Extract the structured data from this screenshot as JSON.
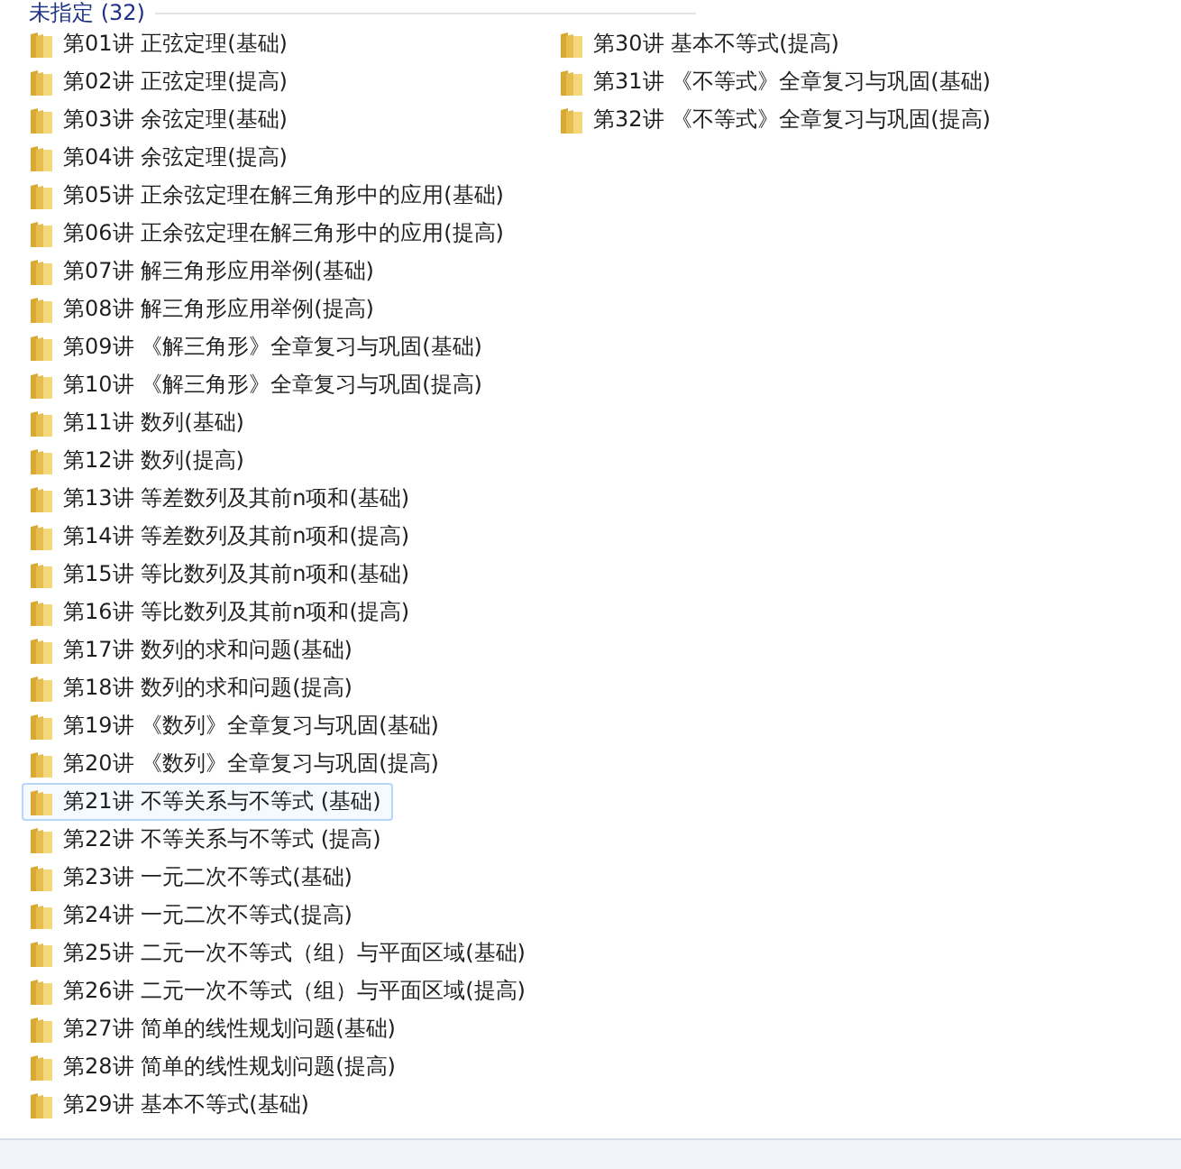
{
  "group": {
    "title": "未指定 (32)"
  },
  "items": [
    {
      "name": "第01讲 正弦定理(基础)",
      "selected": false
    },
    {
      "name": "第02讲 正弦定理(提高)",
      "selected": false
    },
    {
      "name": "第03讲 余弦定理(基础)",
      "selected": false
    },
    {
      "name": "第04讲 余弦定理(提高)",
      "selected": false
    },
    {
      "name": "第05讲 正余弦定理在解三角形中的应用(基础)",
      "selected": false
    },
    {
      "name": "第06讲 正余弦定理在解三角形中的应用(提高)",
      "selected": false
    },
    {
      "name": "第07讲 解三角形应用举例(基础)",
      "selected": false
    },
    {
      "name": "第08讲 解三角形应用举例(提高)",
      "selected": false
    },
    {
      "name": "第09讲 《解三角形》全章复习与巩固(基础)",
      "selected": false
    },
    {
      "name": "第10讲 《解三角形》全章复习与巩固(提高)",
      "selected": false
    },
    {
      "name": "第11讲 数列(基础)",
      "selected": false
    },
    {
      "name": "第12讲 数列(提高)",
      "selected": false
    },
    {
      "name": "第13讲 等差数列及其前n项和(基础)",
      "selected": false
    },
    {
      "name": "第14讲 等差数列及其前n项和(提高)",
      "selected": false
    },
    {
      "name": "第15讲 等比数列及其前n项和(基础)",
      "selected": false
    },
    {
      "name": "第16讲 等比数列及其前n项和(提高)",
      "selected": false
    },
    {
      "name": "第17讲 数列的求和问题(基础)",
      "selected": false
    },
    {
      "name": "第18讲 数列的求和问题(提高)",
      "selected": false
    },
    {
      "name": "第19讲 《数列》全章复习与巩固(基础)",
      "selected": false
    },
    {
      "name": "第20讲 《数列》全章复习与巩固(提高)",
      "selected": false
    },
    {
      "name": "第21讲 不等关系与不等式 (基础)",
      "selected": true
    },
    {
      "name": "第22讲 不等关系与不等式 (提高)",
      "selected": false
    },
    {
      "name": "第23讲 一元二次不等式(基础)",
      "selected": false
    },
    {
      "name": "第24讲 一元二次不等式(提高)",
      "selected": false
    },
    {
      "name": "第25讲 二元一次不等式（组）与平面区域(基础)",
      "selected": false
    },
    {
      "name": "第26讲 二元一次不等式（组）与平面区域(提高)",
      "selected": false
    },
    {
      "name": "第27讲 简单的线性规划问题(基础)",
      "selected": false
    },
    {
      "name": "第28讲 简单的线性规划问题(提高)",
      "selected": false
    },
    {
      "name": "第29讲 基本不等式(基础)",
      "selected": false
    },
    {
      "name": "第30讲 基本不等式(提高)",
      "selected": false
    },
    {
      "name": "第31讲 《不等式》全章复习与巩固(基础)",
      "selected": false
    },
    {
      "name": "第32讲 《不等式》全章复习与巩固(提高)",
      "selected": false
    }
  ]
}
